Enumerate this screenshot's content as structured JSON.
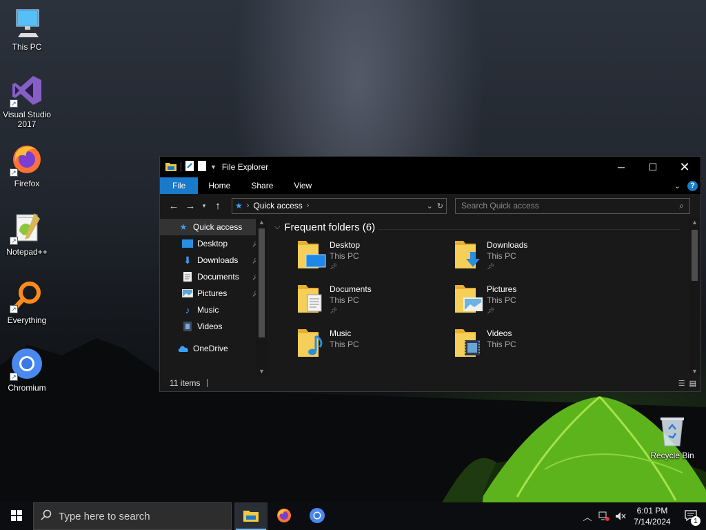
{
  "desktop": {
    "icons": [
      {
        "label": "This PC",
        "icon": "computer-icon"
      },
      {
        "label": "Visual Studio 2017",
        "icon": "visual-studio-icon"
      },
      {
        "label": "Firefox",
        "icon": "firefox-icon"
      },
      {
        "label": "Notepad++",
        "icon": "notepad-plus-plus-icon"
      },
      {
        "label": "Everything",
        "icon": "everything-search-icon"
      },
      {
        "label": "Chromium",
        "icon": "chromium-icon"
      },
      {
        "label": "Recycle Bin",
        "icon": "recycle-bin-icon"
      }
    ]
  },
  "explorer": {
    "title": "File Explorer",
    "ribbon_tabs": [
      "File",
      "Home",
      "Share",
      "View"
    ],
    "address": {
      "crumb": "Quick access"
    },
    "search": {
      "placeholder": "Search Quick access"
    },
    "nav_pane": {
      "items": [
        {
          "label": "Quick access",
          "icon": "star-icon",
          "pinned": false
        },
        {
          "label": "Desktop",
          "icon": "desktop-folder-icon",
          "pinned": true
        },
        {
          "label": "Downloads",
          "icon": "download-arrow-icon",
          "pinned": true
        },
        {
          "label": "Documents",
          "icon": "document-icon",
          "pinned": true
        },
        {
          "label": "Pictures",
          "icon": "pictures-icon",
          "pinned": true
        },
        {
          "label": "Music",
          "icon": "music-note-icon",
          "pinned": false
        },
        {
          "label": "Videos",
          "icon": "film-icon",
          "pinned": false
        },
        {
          "label": "OneDrive",
          "icon": "cloud-icon",
          "pinned": false
        }
      ]
    },
    "content": {
      "group_title": "Frequent folders (6)",
      "folders": [
        {
          "name": "Desktop",
          "location": "This PC",
          "pinned": true
        },
        {
          "name": "Downloads",
          "location": "This PC",
          "pinned": true
        },
        {
          "name": "Documents",
          "location": "This PC",
          "pinned": true
        },
        {
          "name": "Pictures",
          "location": "This PC",
          "pinned": true
        },
        {
          "name": "Music",
          "location": "This PC",
          "pinned": false
        },
        {
          "name": "Videos",
          "location": "This PC",
          "pinned": false
        }
      ]
    },
    "status": {
      "items_count": "11 items"
    }
  },
  "taskbar": {
    "search_placeholder": "Type here to search",
    "apps": [
      "file-explorer-icon",
      "firefox-icon",
      "chromium-icon"
    ],
    "clock": {
      "time": "6:01 PM",
      "date": "7/14/2024"
    },
    "notification_count": "1"
  },
  "colors": {
    "accent": "#1979ca",
    "window_bg": "#191919",
    "titlebar_bg": "#000000",
    "folder_yellow": "#f3c842"
  }
}
